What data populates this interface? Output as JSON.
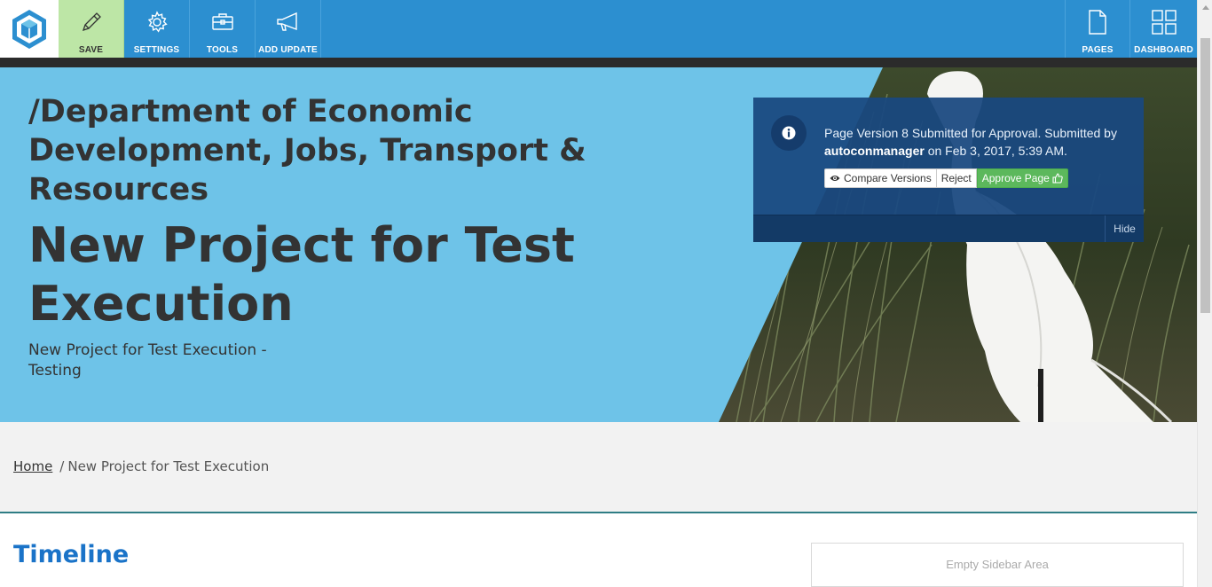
{
  "toolbar": {
    "logo": "app-logo-icon",
    "buttons": [
      {
        "label": "SAVE",
        "icon": "pencil-icon"
      },
      {
        "label": "SETTINGS",
        "icon": "gear-icon"
      },
      {
        "label": "TOOLS",
        "icon": "toolbox-icon"
      },
      {
        "label": "ADD UPDATE",
        "icon": "megaphone-icon"
      }
    ],
    "right_buttons": [
      {
        "label": "PAGES",
        "icon": "page-icon"
      },
      {
        "label": "DASHBOARD",
        "icon": "grid-icon"
      }
    ]
  },
  "hero": {
    "parent_title": "/Department of Economic Development, Jobs, Transport & Resources",
    "title": "New Project for Test Execution",
    "description": "New Project for Test Execution - Testing"
  },
  "notice": {
    "text_before": "Page Version 8 Submitted for Approval. Submitted by ",
    "user": "autoconmanager",
    "text_after": " on Feb 3, 2017, 5:39 AM.",
    "compare_label": "Compare Versions",
    "reject_label": "Reject",
    "approve_label": "Approve Page",
    "hide_label": "Hide"
  },
  "breadcrumb": {
    "home": "Home",
    "separator": "/",
    "current": "New Project for Test Execution"
  },
  "main": {
    "heading": "Timeline",
    "sidebar_label": "Empty Sidebar Area"
  },
  "colors": {
    "toolbar": "#2c8fd0",
    "save_active": "#bde6a6",
    "hero_bg": "#6ec3e8",
    "approve": "#5cb85c",
    "heading": "#1a73c8"
  }
}
